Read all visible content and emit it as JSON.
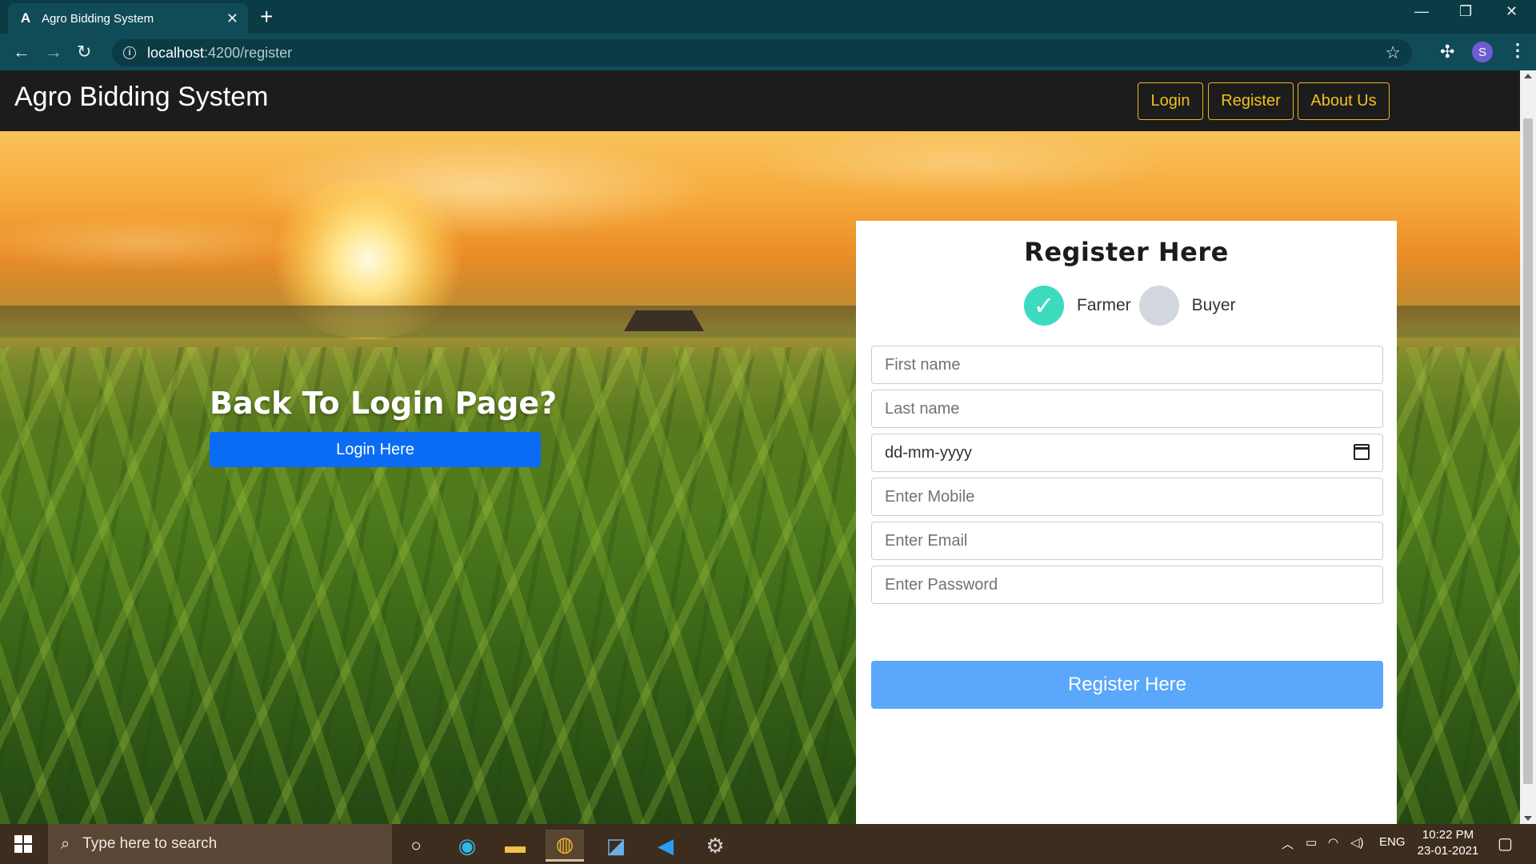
{
  "browser": {
    "tab_favicon": "A",
    "tab_title": "Agro Bidding System",
    "tab_close": "✕",
    "new_tab": "+",
    "url_host": "localhost",
    "url_path": ":4200/register",
    "profile_initial": "S"
  },
  "navbar": {
    "brand": "Agro Bidding System",
    "links": [
      {
        "label": "Login"
      },
      {
        "label": "Register"
      },
      {
        "label": "About Us"
      }
    ]
  },
  "hero": {
    "prompt_title": "Back To Login Page?",
    "login_button": "Login Here"
  },
  "register_form": {
    "title": "Register Here",
    "role_options": [
      {
        "label": "Farmer",
        "checked": true
      },
      {
        "label": "Buyer",
        "checked": false
      }
    ],
    "fields": {
      "first_name": "First name",
      "last_name": "Last name",
      "dob": "dd-mm-yyyy",
      "mobile": "Enter Mobile",
      "email": "Enter Email",
      "password": "Enter Password"
    },
    "submit": "Register Here"
  },
  "taskbar": {
    "search_placeholder": "Type here to search",
    "language": "ENG",
    "time": "10:22 PM",
    "date": "23-01-2021"
  },
  "colors": {
    "browser_frame": "#0b3b45",
    "navbar_bg": "#1c1c1c",
    "nav_link_accent": "#f0c020",
    "login_button": "#0a6cf5",
    "register_button": "#5aa7fb",
    "radio_checked": "#3cdbc0"
  }
}
